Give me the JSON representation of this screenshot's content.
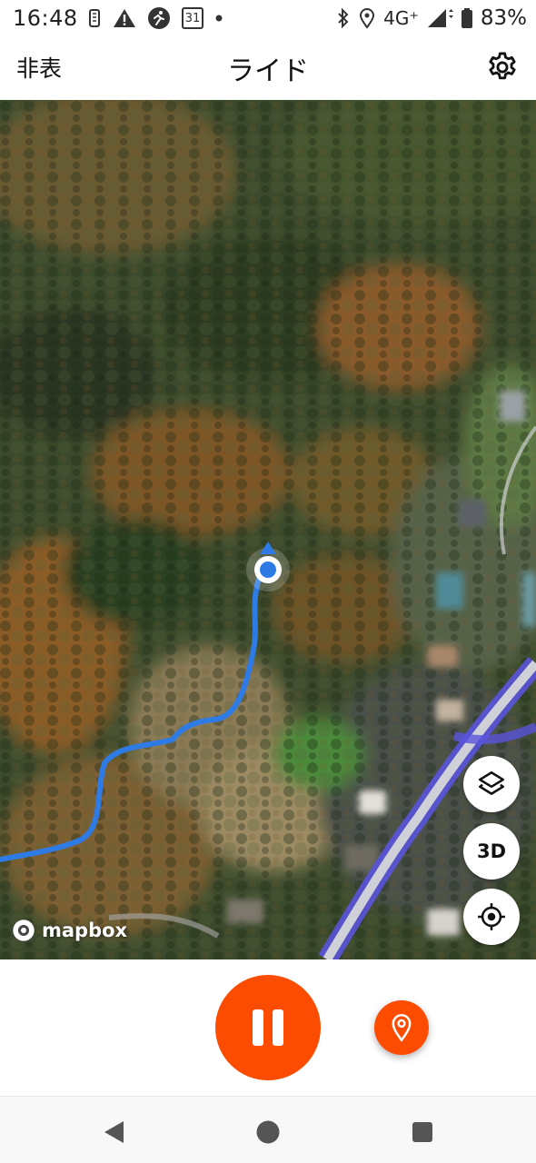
{
  "status_bar": {
    "time": "16:48",
    "calendar_day": "31",
    "network": "4G⁺",
    "battery": "83%"
  },
  "header": {
    "hide_label": "非表",
    "title": "ライド"
  },
  "map": {
    "attribution": "mapbox",
    "three_d_label": "3D",
    "route_color": "#2f7be6",
    "road_color": "#5550d8"
  },
  "controls": {
    "accent_color": "#fc4c02"
  },
  "icons": {
    "settings": "gear-icon",
    "layers": "layers-icon",
    "locate": "crosshair-icon",
    "pause": "pause-icon",
    "pin": "map-pin-icon",
    "back": "back-triangle-icon",
    "home": "home-circle-icon",
    "recents": "recents-square-icon"
  }
}
